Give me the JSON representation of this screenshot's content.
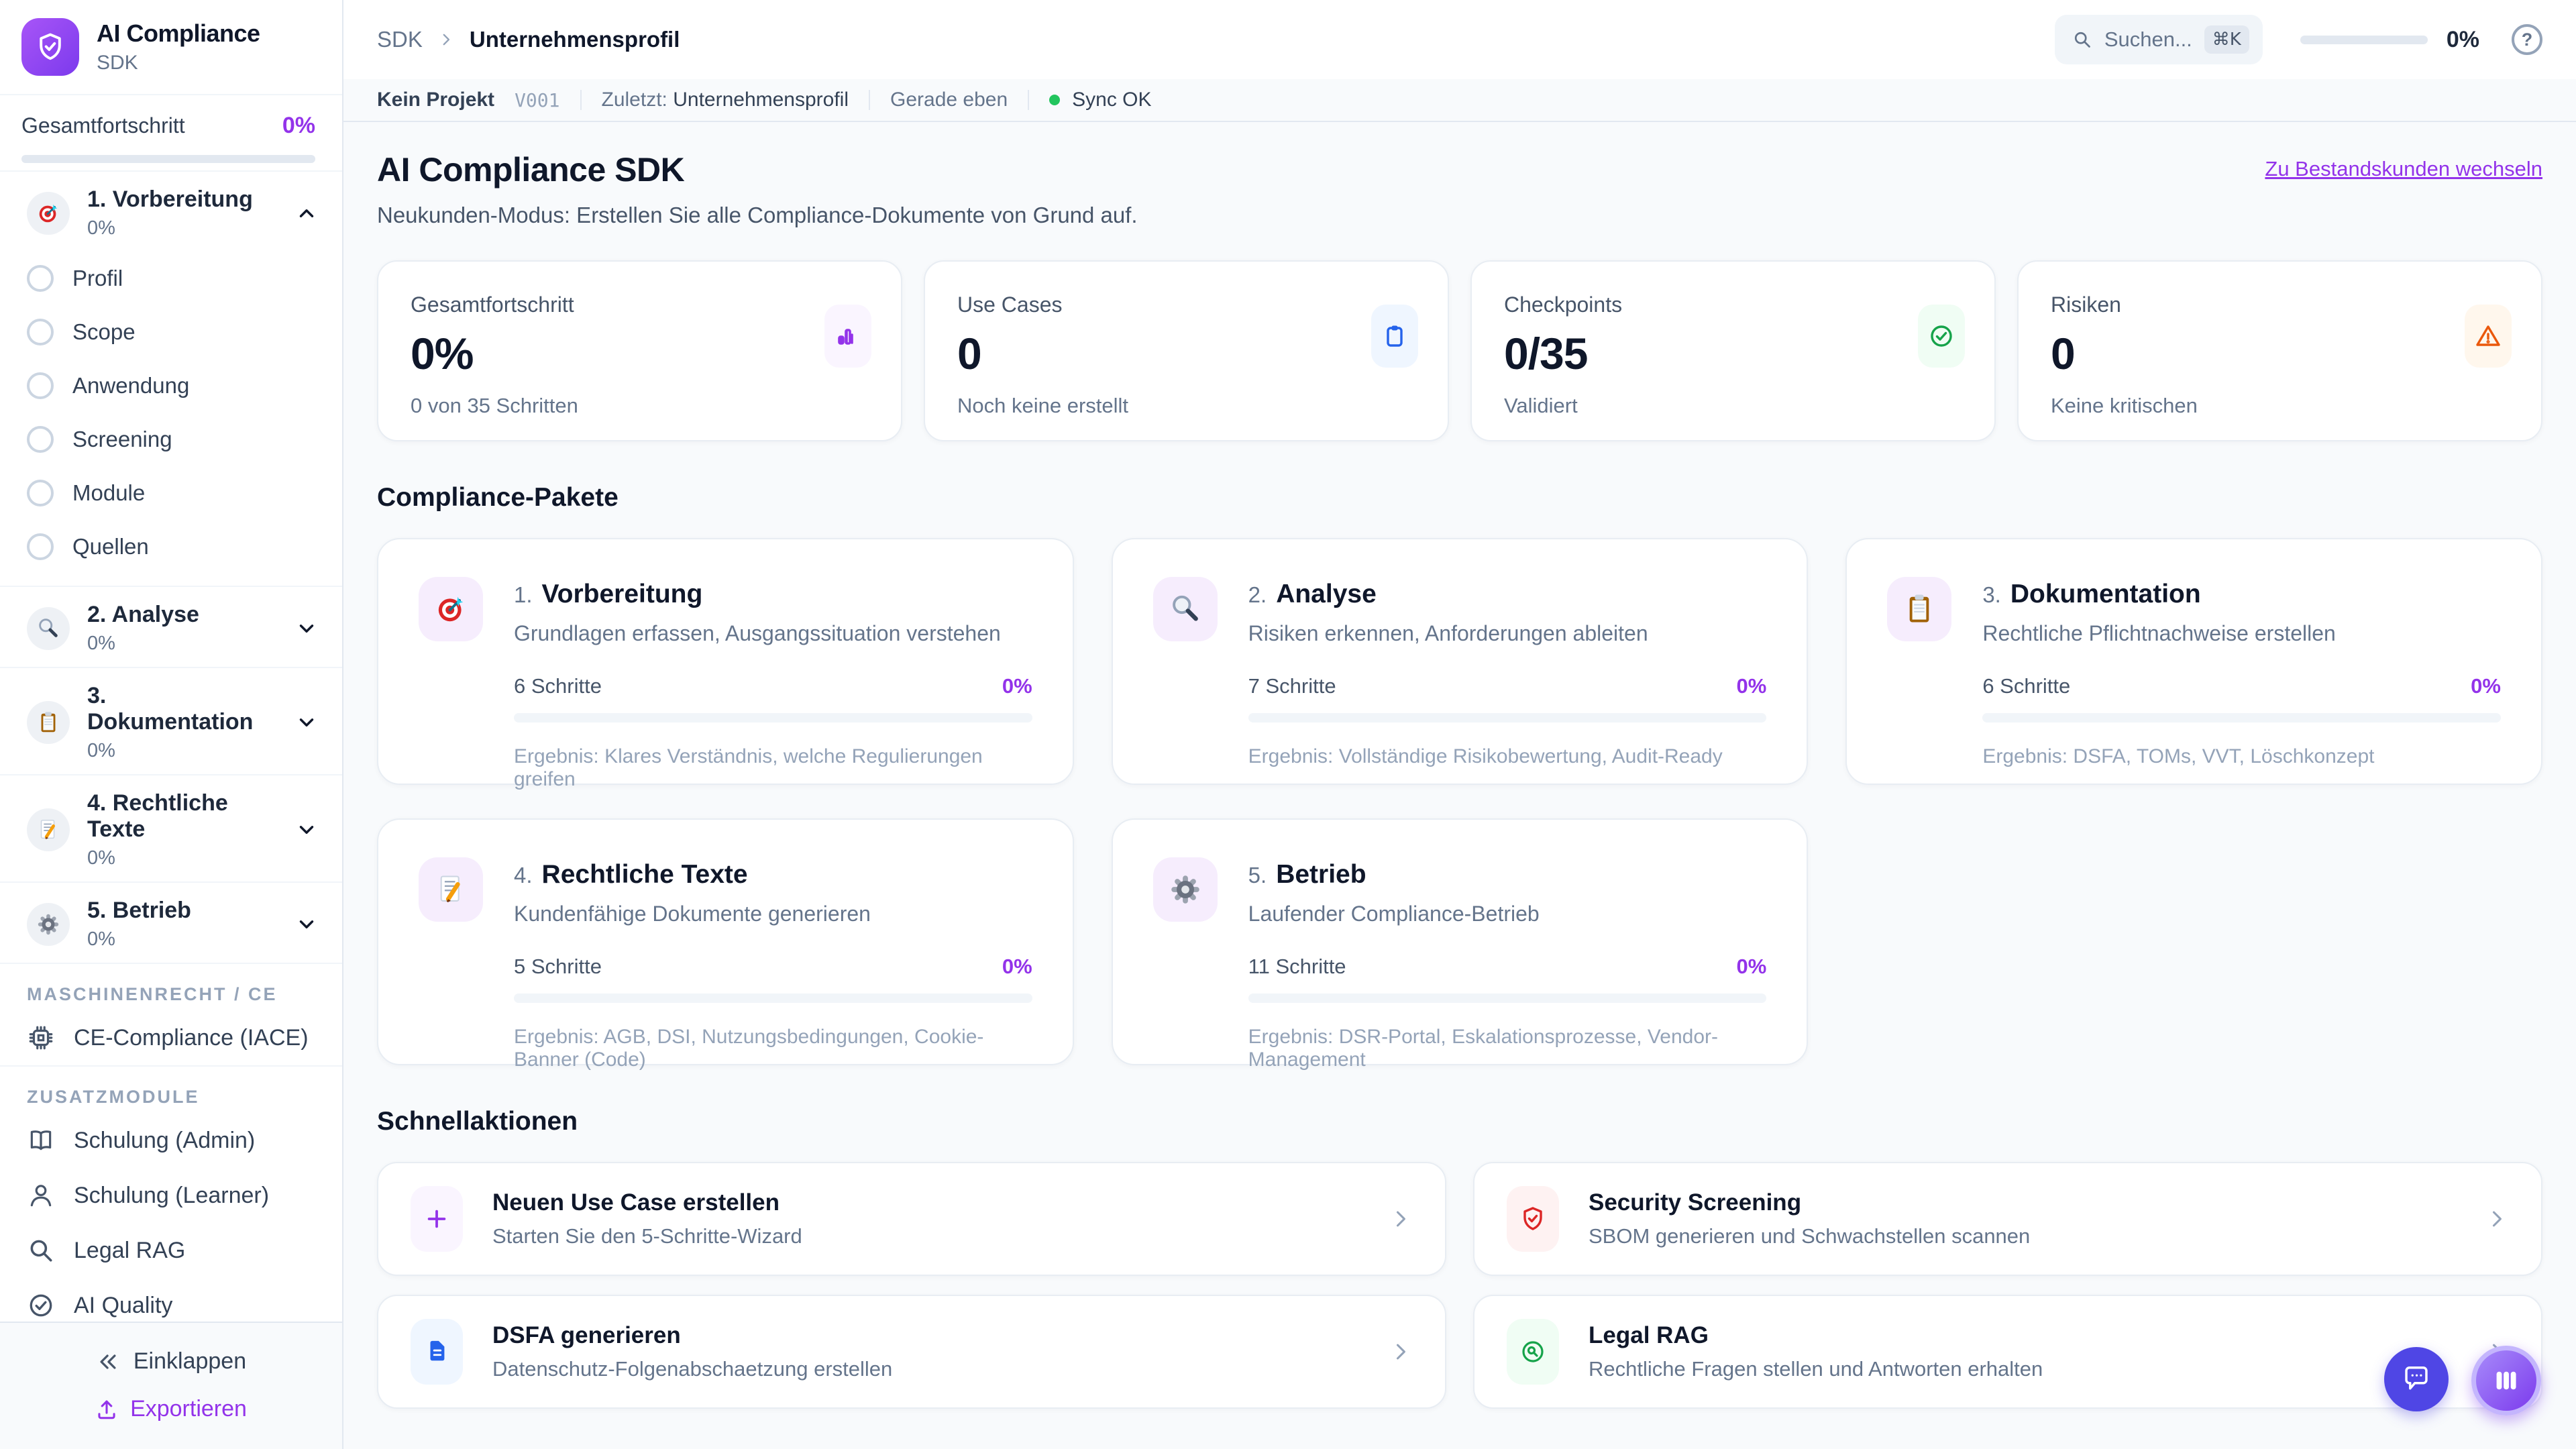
{
  "colors": {
    "accent_purple": "#9333ea",
    "logo_gradient_from": "#a855f7",
    "logo_gradient_to": "#7c3aed",
    "blue": "#2563eb",
    "green": "#16a34a",
    "orange": "#ea580c",
    "red": "#dc2626",
    "indigo_fab": "#4f46e5",
    "sync_green": "#22c55e",
    "background": "#f8fafc"
  },
  "sidebar": {
    "logo_title": "AI Compliance",
    "logo_subtitle": "SDK",
    "overall_label": "Gesamtfortschritt",
    "overall_value": "0%",
    "packages": [
      {
        "num": "1.",
        "label": "1. Vorbereitung",
        "pct": "0%",
        "icon": "target-emoji",
        "state": "expanded"
      },
      {
        "num": "2.",
        "label": "2. Analyse",
        "pct": "0%",
        "icon": "magnifier-emoji",
        "state": "collapsed"
      },
      {
        "num": "3.",
        "label": "3. Dokumentation",
        "pct": "0%",
        "icon": "clipboard-emoji",
        "state": "collapsed"
      },
      {
        "num": "4.",
        "label": "4. Rechtliche Texte",
        "pct": "0%",
        "icon": "memo-emoji",
        "state": "collapsed"
      },
      {
        "num": "5.",
        "label": "5. Betrieb",
        "pct": "0%",
        "icon": "gear-emoji",
        "state": "collapsed"
      }
    ],
    "steps": [
      "Profil",
      "Scope",
      "Anwendung",
      "Screening",
      "Module",
      "Quellen"
    ],
    "section_machine": "MASCHINENRECHT / CE",
    "ce_item": "CE-Compliance (IACE)",
    "section_addons": "ZUSATZMODULE",
    "addons": [
      "Schulung (Admin)",
      "Schulung (Learner)",
      "Legal RAG",
      "AI Quality"
    ],
    "collapse_label": "Einklappen",
    "export_label": "Exportieren"
  },
  "header": {
    "breadcrumb_root": "SDK",
    "breadcrumb_current": "Unternehmensprofil",
    "search_placeholder": "Suchen...",
    "search_shortcut": "⌘K",
    "progress_value": "0%",
    "help_glyph": "?"
  },
  "statusbar": {
    "project": "Kein Projekt",
    "version": "V001",
    "last_label": "Zuletzt:",
    "last_value": "Unternehmensprofil",
    "time": "Gerade eben",
    "sync": "Sync OK"
  },
  "page": {
    "title": "AI Compliance SDK",
    "subtitle": "Neukunden-Modus: Erstellen Sie alle Compliance-Dokumente von Grund auf.",
    "switch_link": "Zu Bestandskunden wechseln"
  },
  "stats": [
    {
      "label": "Gesamtfortschritt",
      "value": "0%",
      "sub": "0 von 35 Schritten",
      "icon": "bar-chart-icon"
    },
    {
      "label": "Use Cases",
      "value": "0",
      "sub": "Noch keine erstellt",
      "icon": "clipboard-icon"
    },
    {
      "label": "Checkpoints",
      "value": "0/35",
      "sub": "Validiert",
      "icon": "check-circle-icon"
    },
    {
      "label": "Risiken",
      "value": "0",
      "sub": "Keine kritischen",
      "icon": "alert-triangle-icon"
    }
  ],
  "packages_section": {
    "title": "Compliance-Pakete",
    "cards": [
      {
        "num": "1.",
        "title": "Vorbereitung",
        "desc": "Grundlagen erfassen, Ausgangssituation verstehen",
        "steps": "6 Schritte",
        "pct": "0%",
        "result": "Ergebnis: Klares Verständnis, welche Regulierungen greifen",
        "icon": "target-emoji"
      },
      {
        "num": "2.",
        "title": "Analyse",
        "desc": "Risiken erkennen, Anforderungen ableiten",
        "steps": "7 Schritte",
        "pct": "0%",
        "result": "Ergebnis: Vollständige Risikobewertung, Audit-Ready",
        "icon": "magnifier-emoji"
      },
      {
        "num": "3.",
        "title": "Dokumentation",
        "desc": "Rechtliche Pflichtnachweise erstellen",
        "steps": "6 Schritte",
        "pct": "0%",
        "result": "Ergebnis: DSFA, TOMs, VVT, Löschkonzept",
        "icon": "clipboard-emoji"
      },
      {
        "num": "4.",
        "title": "Rechtliche Texte",
        "desc": "Kundenfähige Dokumente generieren",
        "steps": "5 Schritte",
        "pct": "0%",
        "result": "Ergebnis: AGB, DSI, Nutzungsbedingungen, Cookie-Banner (Code)",
        "icon": "memo-emoji"
      },
      {
        "num": "5.",
        "title": "Betrieb",
        "desc": "Laufender Compliance-Betrieb",
        "steps": "11 Schritte",
        "pct": "0%",
        "result": "Ergebnis: DSR-Portal, Eskalationsprozesse, Vendor-Management",
        "icon": "gear-emoji"
      }
    ]
  },
  "quick_section": {
    "title": "Schnellaktionen",
    "cards": [
      {
        "title": "Neuen Use Case erstellen",
        "desc": "Starten Sie den 5-Schritte-Wizard",
        "icon": "plus-icon"
      },
      {
        "title": "Security Screening",
        "desc": "SBOM generieren und Schwachstellen scannen",
        "icon": "shield-check-icon"
      },
      {
        "title": "DSFA generieren",
        "desc": "Datenschutz-Folgenabschaetzung erstellen",
        "icon": "file-text-icon"
      },
      {
        "title": "Legal RAG",
        "desc": "Rechtliche Fragen stellen und Antworten erhalten",
        "icon": "search-circle-icon"
      }
    ]
  }
}
